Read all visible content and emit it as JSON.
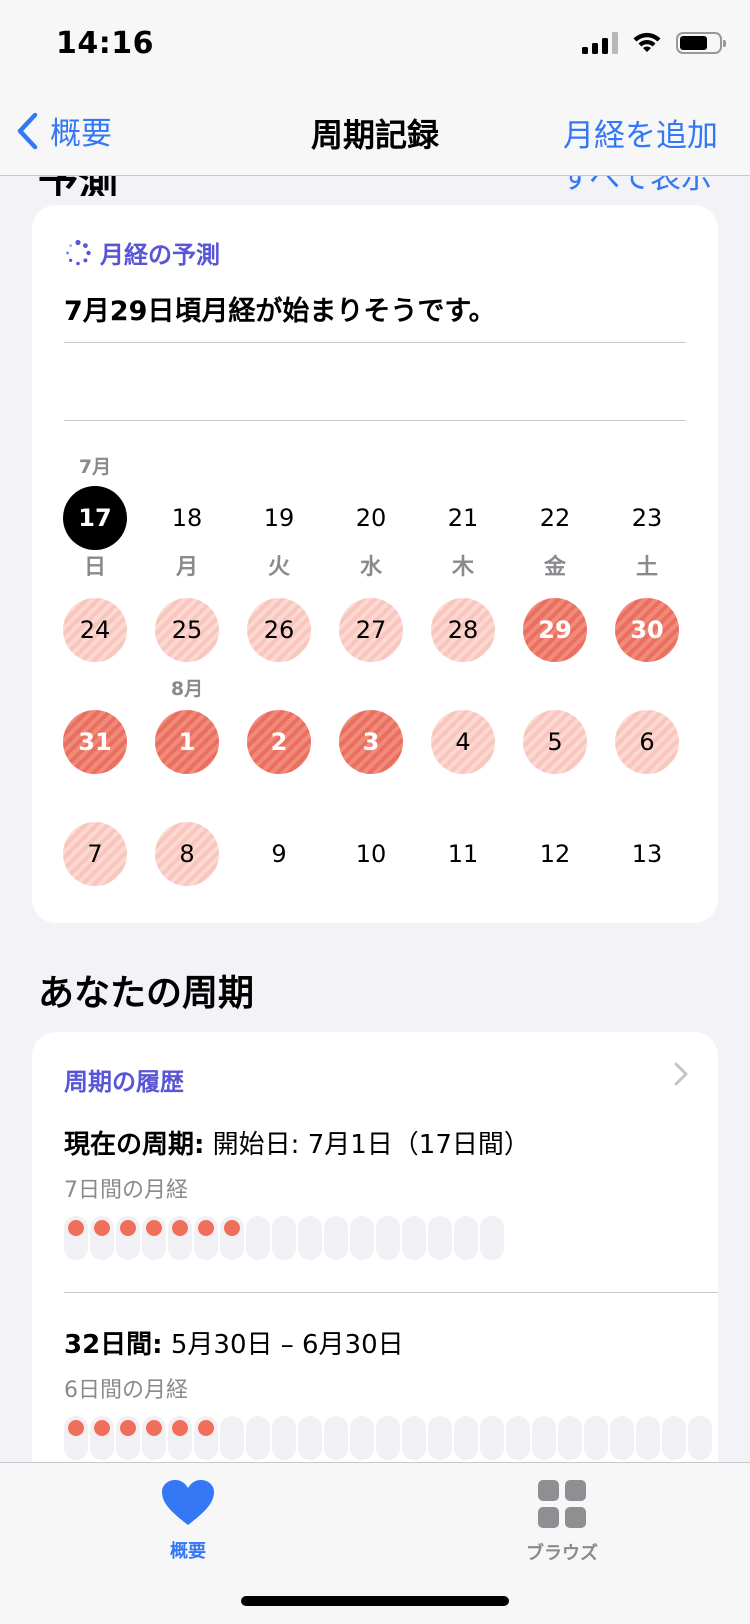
{
  "status": {
    "time": "14:16"
  },
  "nav": {
    "back_label": "概要",
    "title": "周期記録",
    "action_label": "月経を追加"
  },
  "peek": {
    "left": "予測",
    "right": "すべて表示"
  },
  "prediction": {
    "header": "月経の予測",
    "headline": "7月29日頃月経が始まりそうです。",
    "weekdays": [
      "日",
      "月",
      "火",
      "水",
      "木",
      "金",
      "土"
    ],
    "month_labels": {
      "july": "7月",
      "august": "8月"
    },
    "weeks": [
      [
        {
          "d": "17",
          "s": "today"
        },
        {
          "d": "18",
          "s": "none"
        },
        {
          "d": "19",
          "s": "none"
        },
        {
          "d": "20",
          "s": "none"
        },
        {
          "d": "21",
          "s": "none"
        },
        {
          "d": "22",
          "s": "none"
        },
        {
          "d": "23",
          "s": "none"
        }
      ],
      [
        {
          "d": "24",
          "s": "light"
        },
        {
          "d": "25",
          "s": "light"
        },
        {
          "d": "26",
          "s": "light"
        },
        {
          "d": "27",
          "s": "light"
        },
        {
          "d": "28",
          "s": "light"
        },
        {
          "d": "29",
          "s": "heavy"
        },
        {
          "d": "30",
          "s": "heavy"
        }
      ],
      [
        {
          "d": "31",
          "s": "heavy"
        },
        {
          "d": "1",
          "s": "heavy"
        },
        {
          "d": "2",
          "s": "heavy"
        },
        {
          "d": "3",
          "s": "heavy"
        },
        {
          "d": "4",
          "s": "light"
        },
        {
          "d": "5",
          "s": "light"
        },
        {
          "d": "6",
          "s": "light"
        }
      ],
      [
        {
          "d": "7",
          "s": "light"
        },
        {
          "d": "8",
          "s": "light"
        },
        {
          "d": "9",
          "s": "none"
        },
        {
          "d": "10",
          "s": "none"
        },
        {
          "d": "11",
          "s": "none"
        },
        {
          "d": "12",
          "s": "none"
        },
        {
          "d": "13",
          "s": "none"
        }
      ]
    ]
  },
  "cycles": {
    "section_title": "あなたの周期",
    "history_header": "周期の履歴",
    "current": {
      "label": "現在の周期:",
      "value": "開始日: 7月1日（17日間）",
      "sub": "7日間の月経",
      "days_total": 17,
      "period_days": 7
    },
    "previous": {
      "label": "32日間:",
      "value": "5月30日 – 6月30日",
      "sub": "6日間の月経",
      "days_total": 32,
      "period_days": 6
    }
  },
  "tabs": [
    {
      "label": "概要",
      "icon": "heart-icon",
      "active": true
    },
    {
      "label": "ブラウズ",
      "icon": "grid-icon",
      "active": false
    }
  ],
  "colors": {
    "accent": "#3478f6",
    "purple": "#5856d6",
    "period": "#f06f5b"
  }
}
